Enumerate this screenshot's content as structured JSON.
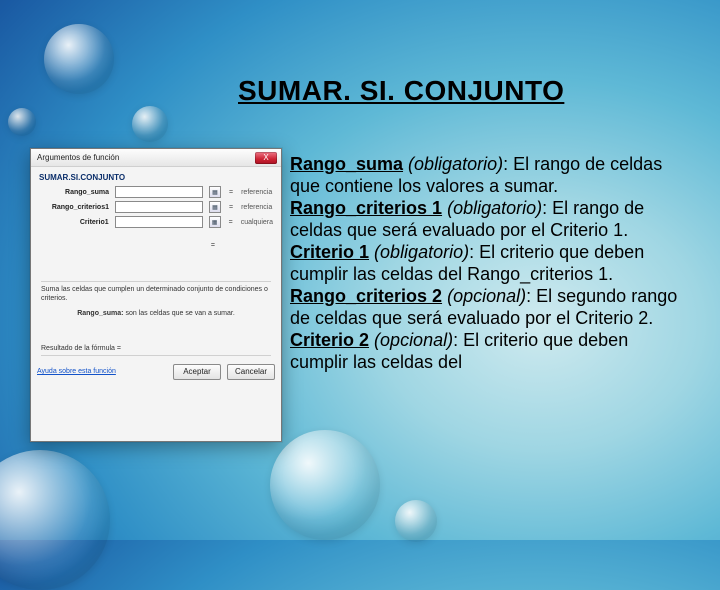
{
  "title": "SUMAR. SI. CONJUNTO",
  "dialog": {
    "windowTitle": "Argumentos de función",
    "close": "X",
    "fnName": "SUMAR.SI.CONJUNTO",
    "rows": [
      {
        "label": "Rango_suma",
        "hint": "referencia"
      },
      {
        "label": "Rango_criterios1",
        "hint": "referencia"
      },
      {
        "label": "Criterio1",
        "hint": "cualquiera"
      }
    ],
    "desc": "Suma las celdas que cumplen un determinado conjunto de condiciones o criterios.",
    "argName": "Rango_suma:",
    "argDesc": "son las celdas que se van a sumar.",
    "resultLabel": "Resultado de la fórmula =",
    "helpLink": "Ayuda sobre esta función",
    "okLabel": "Aceptar",
    "cancelLabel": "Cancelar"
  },
  "definitions": [
    {
      "name": "Rango_suma",
      "req": "(obligatorio)",
      "text": ": El rango de celdas que contiene los valores a sumar."
    },
    {
      "name": "Rango_criterios 1",
      "req": "(obligatorio)",
      "text": ": El rango de celdas que será evaluado por el Criterio 1."
    },
    {
      "name": "Criterio 1",
      "req": "(obligatorio)",
      "text": ": El criterio que deben cumplir las celdas del Rango_criterios 1."
    },
    {
      "name": "Rango_criterios 2",
      "req": "(opcional)",
      "text": ": El segundo rango de celdas que será evaluado por el Criterio 2."
    },
    {
      "name": "Criterio 2",
      "req": "(opcional)",
      "text": ": El criterio que deben cumplir las celdas del"
    }
  ]
}
